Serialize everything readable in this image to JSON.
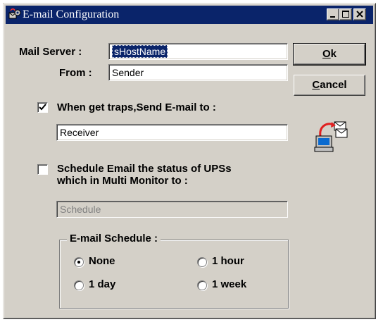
{
  "window": {
    "title": "E-mail Configuration",
    "title_icon": "email-config-icon"
  },
  "title_buttons": {
    "minimize": "minimize-icon",
    "maximize": "maximize-icon",
    "close": "close-icon"
  },
  "mail_server": {
    "label": "Mail Server :",
    "value": "sHostName"
  },
  "from": {
    "label": "From :",
    "value": "Sender"
  },
  "buttons": {
    "ok_accel": "O",
    "ok_rest": "k",
    "cancel_accel": "C",
    "cancel_rest": "ancel"
  },
  "traps": {
    "label": "When get traps,Send E-mail to :",
    "checked": true,
    "receiver": "Receiver"
  },
  "schedule_email": {
    "label_line1": "Schedule Email the status of UPSs",
    "label_line2": "which in Multi Monitor to :",
    "checked": false,
    "placeholder": "Schedule"
  },
  "email_schedule": {
    "title": "E-mail Schedule :",
    "options": [
      "None",
      "1 hour",
      "1 day",
      "1 week"
    ],
    "selected": "None"
  },
  "graphic": {
    "icon": "computer-mail-icon"
  }
}
